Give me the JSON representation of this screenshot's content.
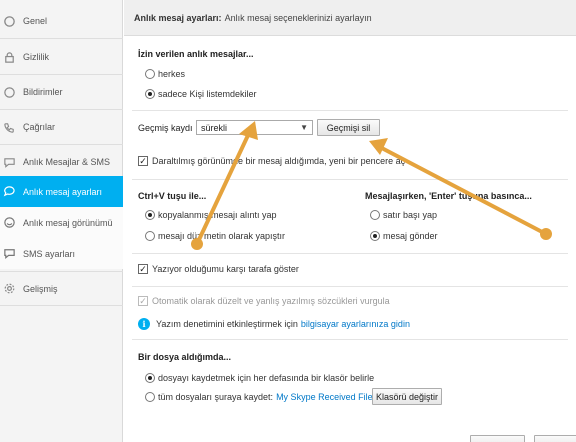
{
  "sidebar": {
    "items": [
      {
        "label": "Genel",
        "icon": "skype-icon"
      },
      {
        "label": "Gizlilik",
        "icon": "lock-icon"
      },
      {
        "label": "Bildirimler",
        "icon": "info-icon"
      },
      {
        "label": "Çağrılar",
        "icon": "phone-icon"
      },
      {
        "label": "Anlık Mesajlar & SMS",
        "icon": "chat-icon"
      },
      {
        "label": "Anlık mesaj ayarları",
        "icon": "chat-bubble-icon"
      },
      {
        "label": "Anlık mesaj görünümü",
        "icon": "smiley-icon"
      },
      {
        "label": "SMS ayarları",
        "icon": "sms-icon"
      },
      {
        "label": "Gelişmiş",
        "icon": "gear-icon"
      }
    ]
  },
  "header": {
    "title": "Anlık mesaj ayarları:",
    "subtitle": "Anlık mesaj seçeneklerinizi ayarlayın"
  },
  "allowed": {
    "title": "İzin verilen anlık mesajlar...",
    "opt_everyone": "herkes",
    "opt_contacts": "sadece Kişi listemdekiler"
  },
  "history": {
    "label": "Geçmiş kaydı",
    "value": "sürekli",
    "clear_button": "Geçmişi sil"
  },
  "compact": {
    "label": "Daraltılmış görünümde bir mesaj aldığımda, yeni bir pencere aç"
  },
  "paste": {
    "title": "Ctrl+V tuşu ile...",
    "opt_quote": "kopyalanmış mesajı alıntı yap",
    "opt_plain": "mesajı düz metin olarak yapıştır"
  },
  "enter": {
    "title": "Mesajlaşırken, 'Enter' tuşuna basınca...",
    "opt_newline": "satır başı yap",
    "opt_send": "mesaj gönder"
  },
  "typing": {
    "label": "Yazıyor olduğumu karşı tarafa göster"
  },
  "spell": {
    "label": "Otomatik olarak düzelt ve yanlış yazılmış sözcükleri vurgula",
    "info_text": "Yazım denetimini etkinleştirmek için",
    "info_link": "bilgisayar ayarlarınıza gidin"
  },
  "files": {
    "title": "Bir dosya aldığımda...",
    "opt_ask": "dosyayı kaydetmek için her defasında bir klasör belirle",
    "opt_save": "tüm dosyaları şuraya kaydet:",
    "folder_link": "My Skype Received Files",
    "change_button": "Klasörü değiştir"
  },
  "colors": {
    "accent": "#00aff0",
    "annotation_arrow": "#e5a33d",
    "link": "#0078c8"
  }
}
